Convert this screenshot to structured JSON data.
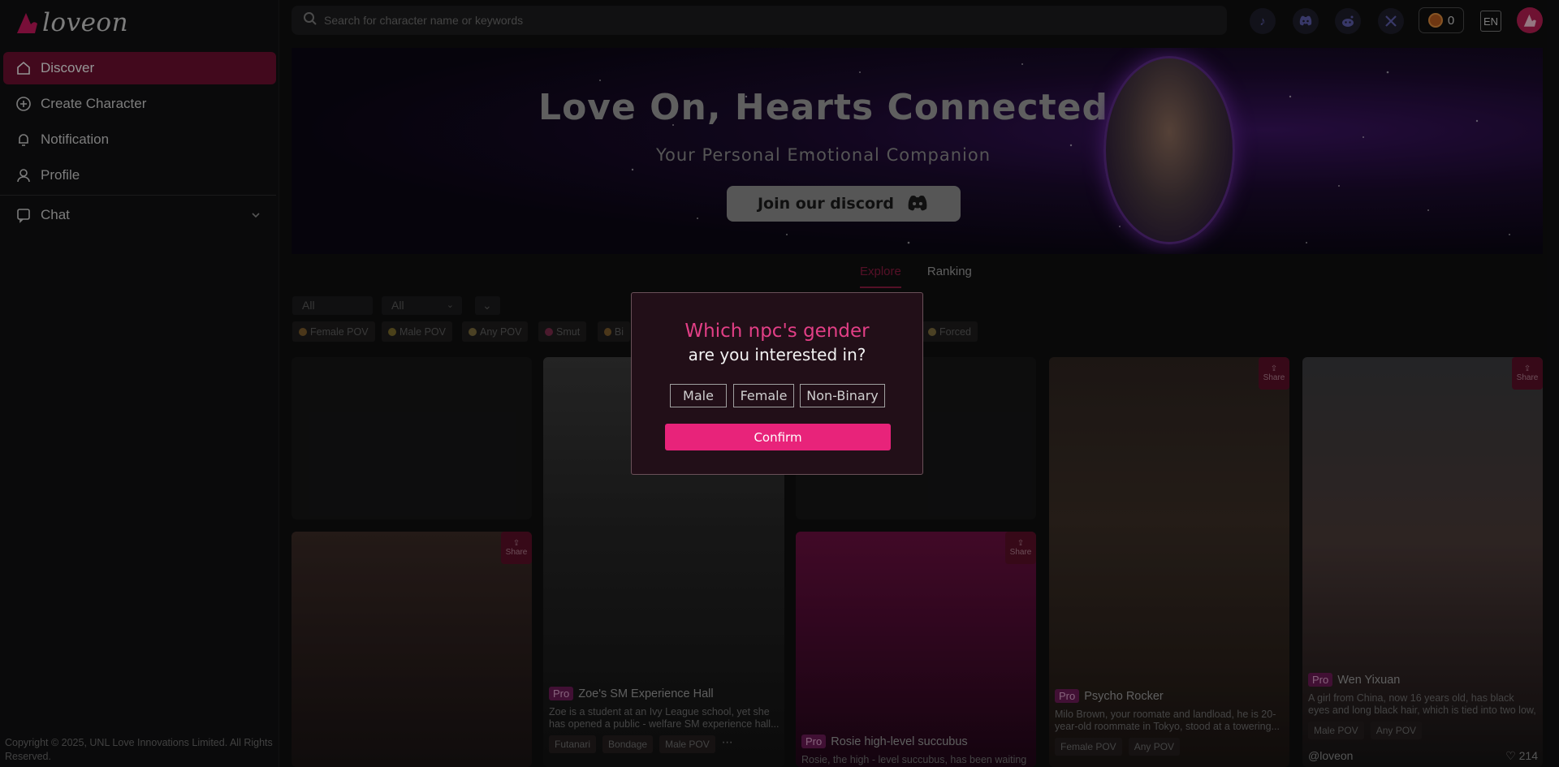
{
  "app": {
    "name": "loveon",
    "brand_color": "#e8237a"
  },
  "sidebar": {
    "items": [
      {
        "label": "Discover",
        "icon": "home-icon",
        "active": true
      },
      {
        "label": "Create Character",
        "icon": "plus-circle-icon"
      },
      {
        "label": "Notification",
        "icon": "bell-icon"
      },
      {
        "label": "Profile",
        "icon": "user-icon"
      },
      {
        "label": "Chat",
        "icon": "chat-icon"
      }
    ],
    "copyright": "Copyright © 2025, UNL Love Innovations Limited. All Rights Reserved."
  },
  "header": {
    "search_placeholder": "Search for character name or keywords",
    "social": [
      "tiktok-icon",
      "discord-icon",
      "reddit-icon",
      "x-icon"
    ],
    "coins": "0",
    "language": "EN"
  },
  "banner": {
    "title": "Love On, Hearts Connected",
    "subtitle": "Your Personal Emotional Companion",
    "discord_label": "Join our discord"
  },
  "tabs": [
    {
      "label": "Explore",
      "active": true
    },
    {
      "label": "Ranking",
      "active": false
    }
  ],
  "filters": {
    "select1": "All",
    "select2": "All",
    "tags": [
      "Female POV",
      "Male POV",
      "Any POV",
      "Smut",
      "Bi",
      "Forced"
    ]
  },
  "cards": [
    {
      "pro": "Pro",
      "title": "Zoe's SM Experience Hall",
      "desc": "Zoe is a student at an Ivy League school, yet she has opened a public - welfare SM experience hall...",
      "tags": [
        "Futanari",
        "Bondage",
        "Male POV"
      ]
    },
    {
      "pro": "Pro",
      "title": "Rosie high-level succubus",
      "desc": "Rosie, the high - level succubus, has been waiting"
    },
    {
      "pro": "Pro",
      "title": "Psycho Rocker",
      "desc": "Milo Brown, your roomate and landload, he is 20-year-old roommate in Tokyo, stood at a towering...",
      "tags": [
        "Female POV",
        "Any POV"
      ]
    },
    {
      "pro": "Pro",
      "title": "Wen Yixuan",
      "desc": "A girl from China, now 16 years old, has black eyes and long black hair, which is tied into two low, th...",
      "tags": [
        "Male POV",
        "Any POV"
      ],
      "author": "@loveon",
      "likes": "214"
    }
  ],
  "share_label": "Share",
  "modal": {
    "title": "Which npc's gender",
    "subtitle": "are you interested in?",
    "options": [
      "Male",
      "Female",
      "Non-Binary"
    ],
    "confirm": "Confirm"
  }
}
